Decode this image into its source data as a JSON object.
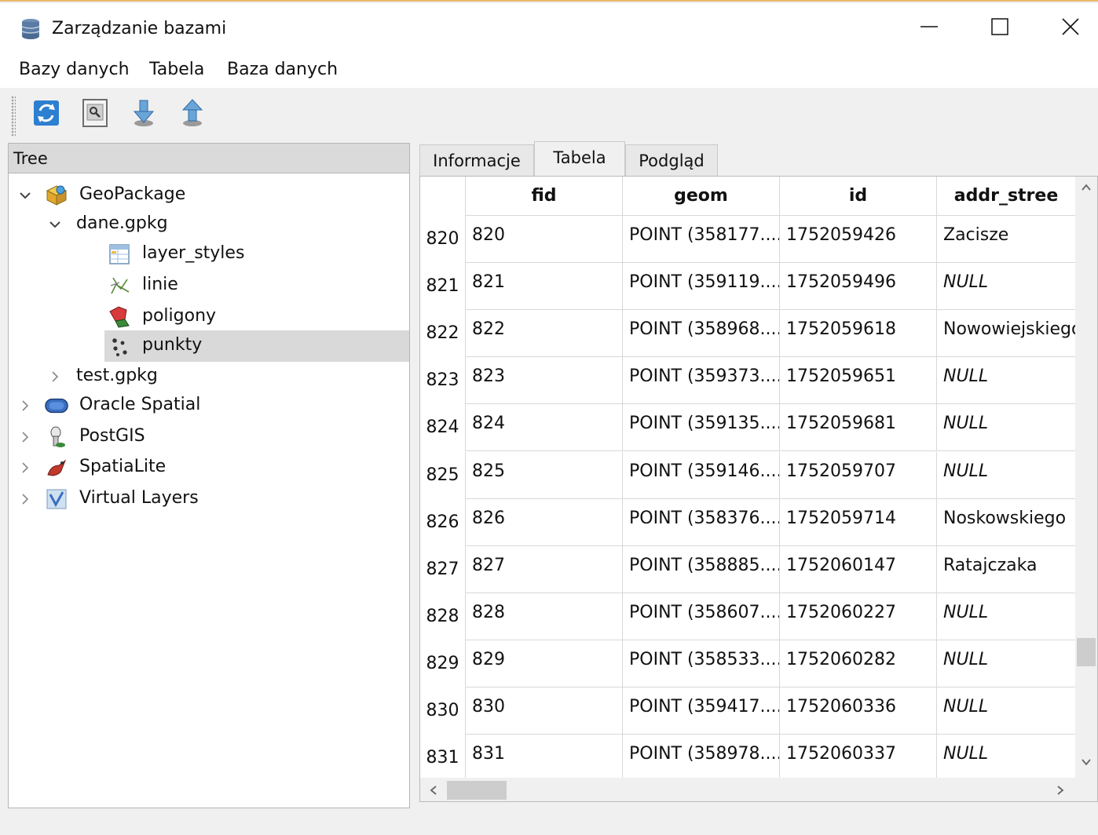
{
  "window": {
    "title": "Zarządzanie bazami",
    "controls": [
      "minimize",
      "maximize",
      "close"
    ]
  },
  "menu": {
    "items": [
      "Bazy danych",
      "Tabela",
      "Baza danych"
    ]
  },
  "toolbar": {
    "buttons": [
      "refresh-icon",
      "sql-window-icon",
      "import-layer-icon",
      "export-icon"
    ]
  },
  "tree": {
    "header": "Tree",
    "nodes": [
      {
        "label": "GeoPackage",
        "icon": "geopackage-icon",
        "expanded": true
      },
      {
        "label": "dane.gpkg",
        "icon": "",
        "expanded": true
      },
      {
        "label": "layer_styles",
        "icon": "table-icon"
      },
      {
        "label": "linie",
        "icon": "line-layer-icon"
      },
      {
        "label": "poligony",
        "icon": "polygon-layer-icon"
      },
      {
        "label": "punkty",
        "icon": "point-layer-icon",
        "selected": true
      },
      {
        "label": "test.gpkg",
        "icon": "",
        "expanded": false
      },
      {
        "label": "Oracle Spatial",
        "icon": "oracle-icon",
        "expanded": false
      },
      {
        "label": "PostGIS",
        "icon": "postgis-icon",
        "expanded": false
      },
      {
        "label": "SpatiaLite",
        "icon": "spatialite-icon",
        "expanded": false
      },
      {
        "label": "Virtual Layers",
        "icon": "virtual-layers-icon",
        "expanded": false
      }
    ]
  },
  "tabs": {
    "items": [
      "Informacje",
      "Tabela",
      "Podgląd"
    ],
    "active": "Tabela"
  },
  "table": {
    "columns": [
      "fid",
      "geom",
      "id",
      "addr_stree"
    ],
    "rows": [
      {
        "num": "820",
        "fid": "820",
        "geom": "POINT (358177....",
        "id": "1752059426",
        "addr": "Zacisze"
      },
      {
        "num": "821",
        "fid": "821",
        "geom": "POINT (359119....",
        "id": "1752059496",
        "addr": "NULL"
      },
      {
        "num": "822",
        "fid": "822",
        "geom": "POINT (358968....",
        "id": "1752059618",
        "addr": "Nowowiejskiego"
      },
      {
        "num": "823",
        "fid": "823",
        "geom": "POINT (359373....",
        "id": "1752059651",
        "addr": "NULL"
      },
      {
        "num": "824",
        "fid": "824",
        "geom": "POINT (359135....",
        "id": "1752059681",
        "addr": "NULL"
      },
      {
        "num": "825",
        "fid": "825",
        "geom": "POINT (359146....",
        "id": "1752059707",
        "addr": "NULL"
      },
      {
        "num": "826",
        "fid": "826",
        "geom": "POINT (358376....",
        "id": "1752059714",
        "addr": "Noskowskiego"
      },
      {
        "num": "827",
        "fid": "827",
        "geom": "POINT (358885....",
        "id": "1752060147",
        "addr": "Ratajczaka"
      },
      {
        "num": "828",
        "fid": "828",
        "geom": "POINT (358607....",
        "id": "1752060227",
        "addr": "NULL"
      },
      {
        "num": "829",
        "fid": "829",
        "geom": "POINT (358533....",
        "id": "1752060282",
        "addr": "NULL"
      },
      {
        "num": "830",
        "fid": "830",
        "geom": "POINT (359417....",
        "id": "1752060336",
        "addr": "NULL"
      },
      {
        "num": "831",
        "fid": "831",
        "geom": "POINT (358978....",
        "id": "1752060337",
        "addr": "NULL"
      }
    ]
  },
  "colors": {
    "accent_top": "#e8b86a",
    "selection": "#d9d9d9",
    "header_bg": "#dadada"
  }
}
